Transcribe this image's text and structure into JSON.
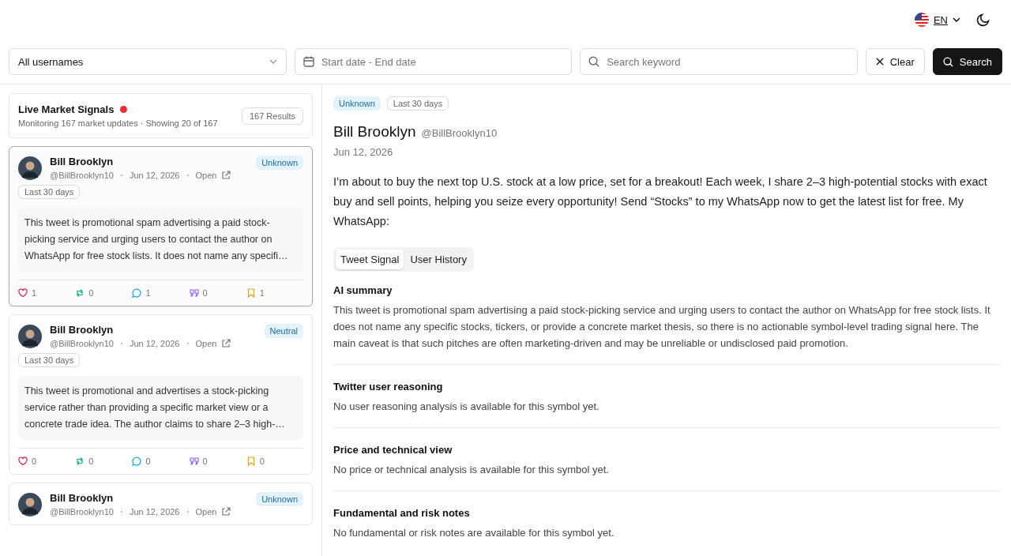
{
  "header": {
    "language": "EN"
  },
  "filters": {
    "username": "All usernames",
    "date": {
      "placeholder": "Start date - End date"
    },
    "search": {
      "placeholder": "Search keyword"
    },
    "buttons": [
      {
        "label": "Clear",
        "kind": "clear"
      },
      {
        "label": "Search",
        "kind": "search"
      }
    ]
  },
  "feed": {
    "title": "Live Market Signals",
    "live": true,
    "subtitle": "Monitoring 167 market updates · Showing 20 of 167",
    "count": "167 Results",
    "cards": [
      {
        "selected": true,
        "name": "Bill Brooklyn",
        "handle": "@BillBrooklyn10",
        "date": "Jun 12, 2026",
        "link": "Open",
        "badge": "Unknown",
        "range": "Last 30 days",
        "summary": "This tweet is promotional spam advertising a paid stock-picking service and urging users to contact the author on WhatsApp for free stock lists. It does not name any specifi…",
        "stats": [
          {
            "kind": "likes",
            "value": "1"
          },
          {
            "kind": "retweets",
            "value": "0"
          },
          {
            "kind": "replies",
            "value": "1"
          },
          {
            "kind": "quotes",
            "value": "0"
          },
          {
            "kind": "bookmarks",
            "value": "1"
          }
        ]
      },
      {
        "selected": false,
        "name": "Bill Brooklyn",
        "handle": "@BillBrooklyn10",
        "date": "Jun 12, 2026",
        "link": "Open",
        "badge": "Neutral",
        "range": "Last 30 days",
        "summary": "This tweet is promotional and advertises a stock-picking service rather than providing a specific market view or a concrete trade idea. The author claims to share 2–3 high-…",
        "stats": [
          {
            "kind": "likes",
            "value": "0"
          },
          {
            "kind": "retweets",
            "value": "0"
          },
          {
            "kind": "replies",
            "value": "0"
          },
          {
            "kind": "quotes",
            "value": "0"
          },
          {
            "kind": "bookmarks",
            "value": "0"
          }
        ]
      },
      {
        "selected": false,
        "name": "Bill Brooklyn",
        "handle": "@BillBrooklyn10",
        "date": "Jun 12, 2026",
        "link": "Open",
        "badge": "Unknown"
      }
    ]
  },
  "detail": {
    "badge": "Unknown",
    "range": "Last 30 days",
    "name": "Bill Brooklyn",
    "handle": "@BillBrooklyn10",
    "date": "Jun 12, 2026",
    "text": "I’m about to buy the next top U.S. stock at a low price, set for a breakout! Each week, I share 2–3 high-potential stocks with exact buy and sell points, helping you seize every opportunity! Send “Stocks” to my WhatsApp now to get the latest list for free. My WhatsApp:",
    "tabs": [
      {
        "label": "Tweet Signal",
        "selected": true
      },
      {
        "label": "User History",
        "selected": false
      }
    ],
    "sections": [
      {
        "title": "AI summary",
        "body": "This tweet is promotional spam advertising a paid stock-picking service and urging users to contact the author on WhatsApp for free stock lists. It does not name any specific stocks, tickers, or provide a concrete market thesis, so there is no actionable symbol-level trading signal here. The main caveat is that such pitches are often marketing-driven and may be unreliable or undisclosed paid promotion."
      },
      {
        "title": "Twitter user reasoning",
        "body": "No user reasoning analysis is available for this symbol yet."
      },
      {
        "title": "Price and technical view",
        "body": "No price or technical analysis is available for this symbol yet."
      },
      {
        "title": "Fundamental and risk notes",
        "body": "No fundamental or risk notes are available for this symbol yet."
      }
    ]
  }
}
